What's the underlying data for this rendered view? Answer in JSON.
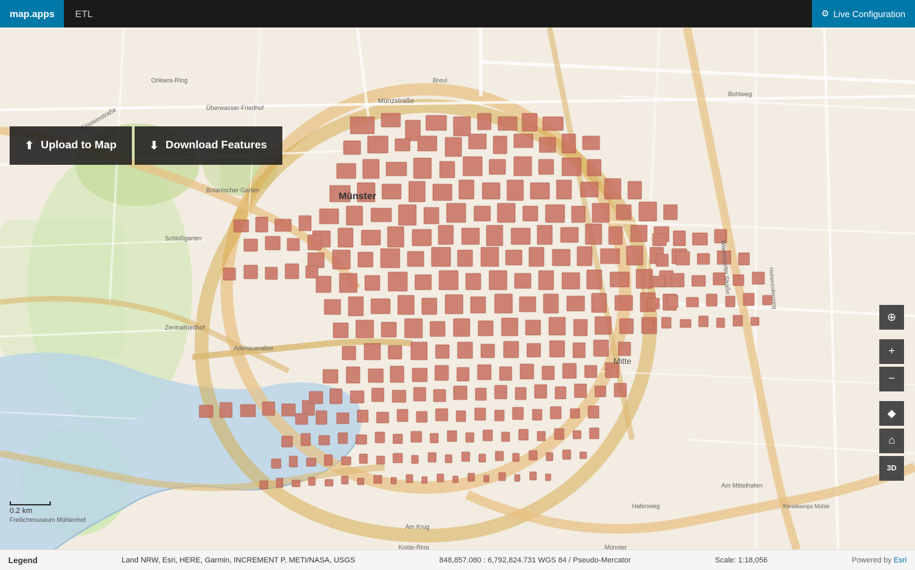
{
  "header": {
    "brand": "map.apps",
    "app_title": "ETL",
    "live_config_label": "Live Configuration",
    "gear_icon": "⚙"
  },
  "buttons": {
    "upload_icon": "⬆",
    "upload_label": "Upload to Map",
    "download_icon": "⬇",
    "download_label": "Download Features"
  },
  "map_controls": {
    "compass": "⊕",
    "zoom_in": "+",
    "zoom_out": "−",
    "diamond": "◆",
    "home": "⌂",
    "threed": "3D"
  },
  "bottom_bar": {
    "legend": "Legend",
    "attribution": "Land NRW, Esri, HERE, Garmin, INCREMENT P, METI/NASA, USGS",
    "coordinates": "848,857.080 : 6,792,824.731  WGS 84 / Pseudo-Mercator",
    "scale": "Scale: 1:18,056",
    "powered_by": "Powered by",
    "esri": "Esri"
  },
  "scale_bar": {
    "label": "0.2 km"
  }
}
